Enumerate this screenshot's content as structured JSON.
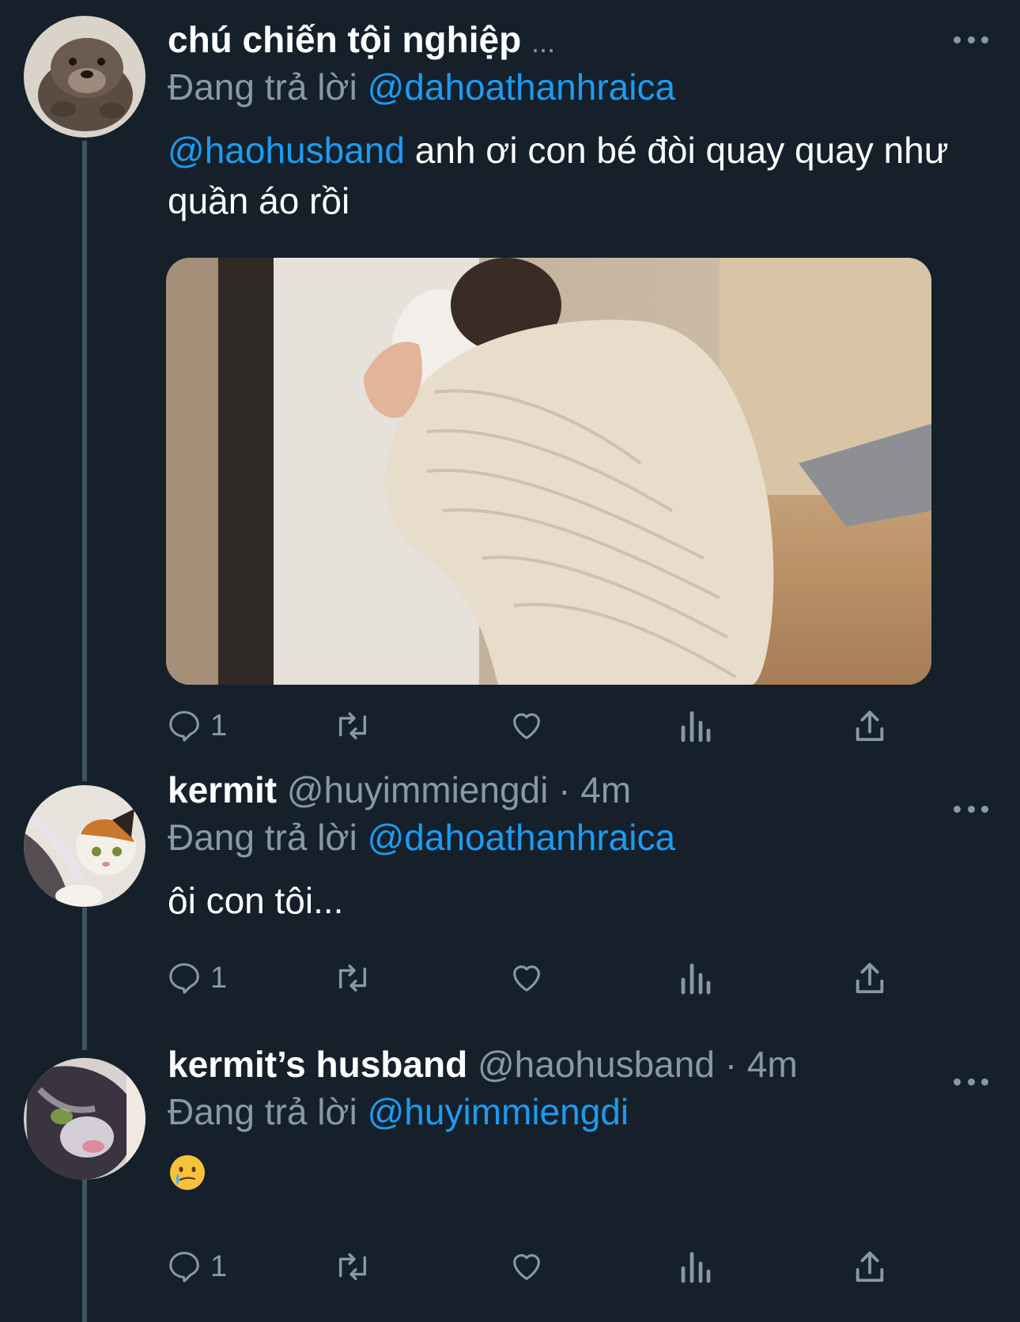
{
  "colors": {
    "background": "#15202b",
    "accent": "#1d9bf0",
    "muted": "#8899a6",
    "thread_line": "#3d5466"
  },
  "reply_prefix": "Đang trả lời",
  "tweets": [
    {
      "name": "chú chiến tội nghiệp",
      "name_overflow": "...",
      "reply_to": "@dahoathanhraica",
      "body_mention": "@haohusband",
      "body_text": " anh ơi con bé đòi quay quay như quần áo rồi",
      "avatar_icon": "otter-avatar",
      "media_icon": "baby-at-washing-machine-photo",
      "reply_count": "1"
    },
    {
      "name": "kermit",
      "handle": "@huyimmiengdi",
      "separator": "·",
      "time": "4m",
      "reply_to": "@dahoathanhraica",
      "body_text": "ôi con tôi...",
      "avatar_icon": "calico-cat-avatar",
      "reply_count": "1"
    },
    {
      "name": "kermit’s husband",
      "handle": "@haohusband",
      "separator": "·",
      "time": "4m",
      "reply_to": "@huyimmiengdi",
      "body_emoji": "🥲",
      "avatar_icon": "blurry-cat-avatar",
      "reply_count": "1"
    }
  ]
}
